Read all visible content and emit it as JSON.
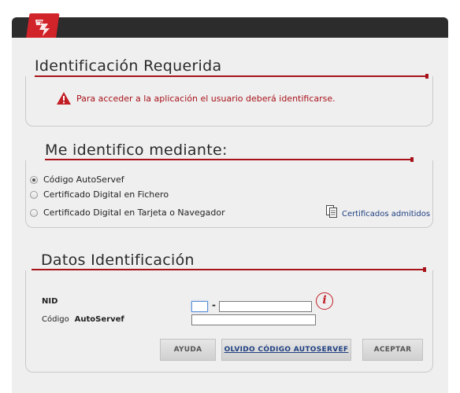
{
  "header": {
    "logo_icon": "generalitat-logo-icon"
  },
  "identification_required": {
    "title": "Identificación Requerida",
    "warning_icon": "warning-triangle-icon",
    "warning_text": "Para acceder a la aplicación el usuario deberá identificarse."
  },
  "identify_via": {
    "title": "Me identifico mediante:",
    "options": [
      {
        "label": "Código AutoServef",
        "checked": true
      },
      {
        "label": "Certificado Digital en Fichero",
        "checked": false
      },
      {
        "label": "Certificado Digital en Tarjeta o Navegador",
        "checked": false
      }
    ],
    "certs_icon": "documents-icon",
    "certs_link": "Certificados admitidos"
  },
  "identification_data": {
    "title": "Datos Identificación",
    "nid_label": "NID",
    "nid_prefix_value": "",
    "nid_separator": "-",
    "nid_value": "",
    "code_label_prefix": "Código",
    "code_label_bold": "AutoServef",
    "code_value": "",
    "info_icon": "info-icon",
    "info_glyph": "i"
  },
  "buttons": {
    "help": "AYUDA",
    "forgot": "OLVIDO CÓDIGO AUTOSERVEF",
    "accept": "ACEPTAR"
  },
  "colors": {
    "accent_red": "#a8121a",
    "link_blue": "#1e3f80",
    "panel_bg": "#efefef",
    "top_bar": "#2c2c2c"
  }
}
